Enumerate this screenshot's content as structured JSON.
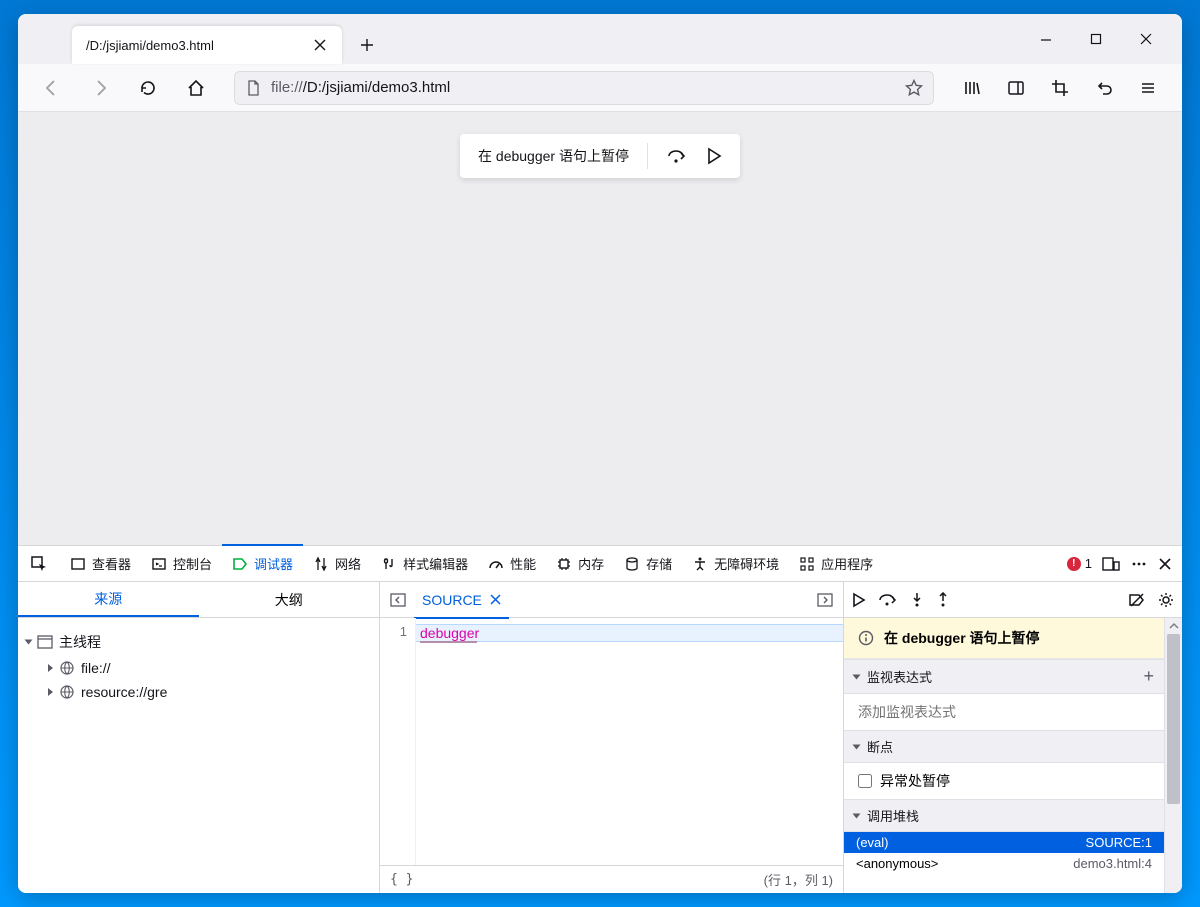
{
  "tab": {
    "title": "/D:/jsjiami/demo3.html"
  },
  "addressbar": {
    "prefix": "file://",
    "path": "/D:/jsjiami/demo3.html"
  },
  "pause_overlay": {
    "text": "在 debugger 语句上暂停"
  },
  "devtools": {
    "tabs": {
      "inspector": "查看器",
      "console": "控制台",
      "debugger": "调试器",
      "network": "网络",
      "style": "样式编辑器",
      "perf": "性能",
      "memory": "内存",
      "storage": "存储",
      "a11y": "无障碍环境",
      "apps": "应用程序"
    },
    "error_count": "1"
  },
  "left": {
    "tabs": {
      "sources": "来源",
      "outline": "大纲"
    },
    "tree": {
      "root": "主线程",
      "file": "file://",
      "resource": "resource://gre"
    }
  },
  "source": {
    "tab_name": "SOURCE",
    "line_no": "1",
    "code": "debugger",
    "footer_left": "{ }",
    "footer_right": "(行 1，列 1)"
  },
  "right": {
    "notice": "在 debugger 语句上暂停",
    "watch": {
      "header": "监视表达式",
      "placeholder": "添加监视表达式"
    },
    "breakpoints": {
      "header": "断点",
      "pause_exc": "异常处暂停"
    },
    "callstack": {
      "header": "调用堆栈",
      "frames": [
        {
          "name": "(eval)",
          "loc": "SOURCE:1",
          "active": true
        },
        {
          "name": "<anonymous>",
          "loc": "demo3.html:4",
          "active": false
        }
      ]
    }
  }
}
